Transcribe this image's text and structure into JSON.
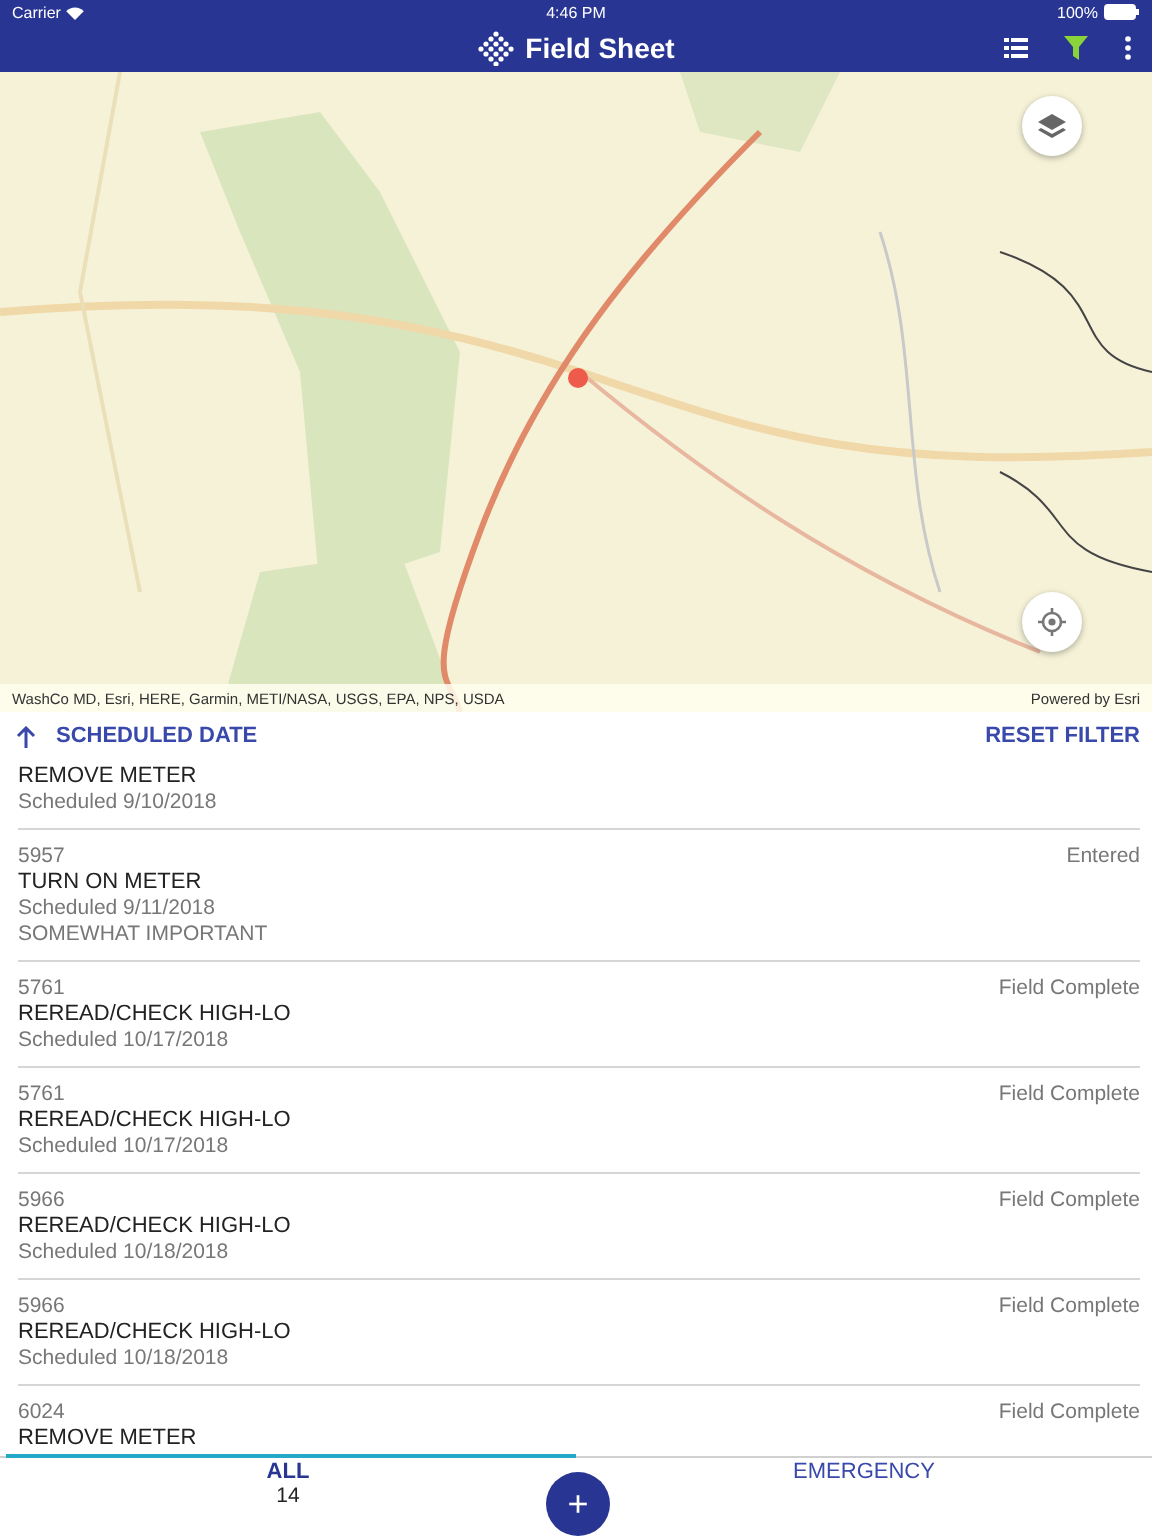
{
  "status_bar": {
    "carrier": "Carrier",
    "time": "4:46 PM",
    "battery": "100%"
  },
  "nav": {
    "title": "Field Sheet"
  },
  "map": {
    "kind": "picture",
    "attribution": "WashCo MD, Esri, HERE, Garmin, METI/NASA, USGS, EPA, NPS, USDA",
    "powered_by": "Powered by Esri"
  },
  "sort_bar": {
    "sort_label": "SCHEDULED DATE",
    "reset": "RESET FILTER"
  },
  "jobs": [
    {
      "title": "REMOVE METER",
      "scheduled": "Scheduled 9/10/2018"
    },
    {
      "id": "5957",
      "status": "Entered",
      "title": "TURN ON METER",
      "scheduled": "Scheduled 9/11/2018",
      "priority": "SOMEWHAT IMPORTANT"
    },
    {
      "id": "5761",
      "status": "Field Complete",
      "title": "REREAD/CHECK HIGH-LO",
      "scheduled": "Scheduled 10/17/2018"
    },
    {
      "id": "5761",
      "status": "Field Complete",
      "title": "REREAD/CHECK HIGH-LO",
      "scheduled": "Scheduled 10/17/2018"
    },
    {
      "id": "5966",
      "status": "Field Complete",
      "title": "REREAD/CHECK HIGH-LO",
      "scheduled": "Scheduled 10/18/2018"
    },
    {
      "id": "5966",
      "status": "Field Complete",
      "title": "REREAD/CHECK HIGH-LO",
      "scheduled": "Scheduled 10/18/2018"
    },
    {
      "id": "6024",
      "status": "Field Complete",
      "title": "REMOVE METER"
    }
  ],
  "tabs": [
    {
      "label": "ALL",
      "count": "14",
      "selected": true
    },
    {
      "label": "EMERGENCY",
      "selected": false
    }
  ],
  "fab": {
    "label": "+"
  }
}
